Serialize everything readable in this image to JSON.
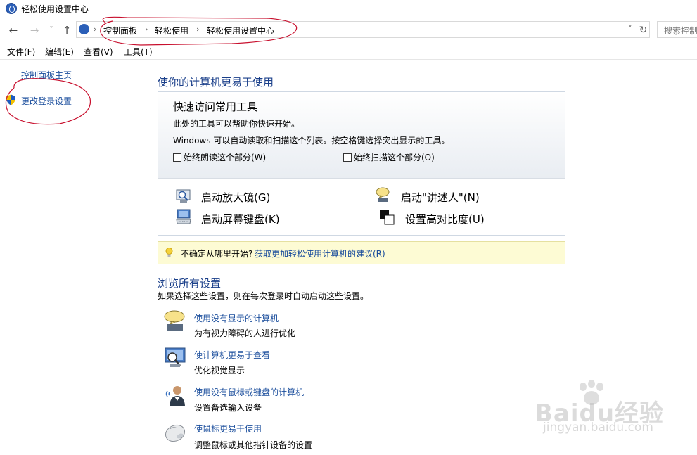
{
  "window": {
    "title": "轻松使用设置中心"
  },
  "address": {
    "crumbs": [
      "控制面板",
      "轻松使用",
      "轻松使用设置中心"
    ],
    "search_placeholder": "搜索控制面板"
  },
  "menu": [
    "文件(F)",
    "编辑(E)",
    "查看(V)",
    "工具(T)"
  ],
  "left_pane": {
    "home": "控制面板主页",
    "login": "更改登录设置"
  },
  "main": {
    "title": "使你的计算机更易于使用",
    "quick": {
      "title": "快速访问常用工具",
      "desc1": "此处的工具可以帮助你快速开始。",
      "desc2": "Windows 可以自动读取和扫描这个列表。按空格键选择突出显示的工具。",
      "check_read": "始终朗读这个部分(W)",
      "check_scan": "始终扫描这个部分(O)",
      "tools": [
        "启动放大镜(G)",
        "启动\"讲述人\"(N)",
        "启动屏幕键盘(K)",
        "设置高对比度(U)"
      ]
    },
    "tip": {
      "text": "不确定从哪里开始?",
      "link": "获取更加轻松使用计算机的建议(R)"
    },
    "browse": {
      "title": "浏览所有设置",
      "subtitle": "如果选择这些设置，则在每次登录时自动启动这些设置。",
      "items": [
        {
          "link": "使用没有显示的计算机",
          "desc": "为有视力障碍的人进行优化"
        },
        {
          "link": "使计算机更易于查看",
          "desc": "优化视觉显示"
        },
        {
          "link": "使用没有鼠标或键盘的计算机",
          "desc": "设置备选输入设备"
        },
        {
          "link": "使鼠标更易于使用",
          "desc": "调整鼠标或其他指针设备的设置"
        }
      ]
    }
  },
  "watermark": {
    "logo": "Baidu经验",
    "url": "jingyan.baidu.com"
  },
  "colors": {
    "link": "#1a4d9c",
    "heading": "#1a3f8a",
    "annotation": "#c8102e",
    "tip_bg": "#fdfbd4"
  }
}
